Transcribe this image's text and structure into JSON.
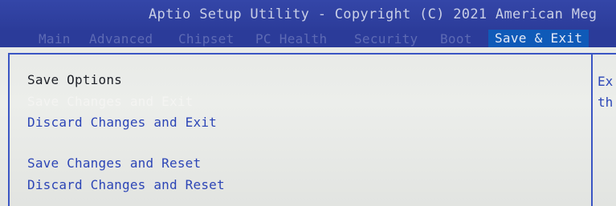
{
  "header": {
    "title": "Aptio Setup Utility - Copyright (C) 2021 American Meg"
  },
  "tabs": [
    {
      "label": "Main",
      "active": false
    },
    {
      "label": "Advanced",
      "active": false
    },
    {
      "label": "Chipset",
      "active": false
    },
    {
      "label": "PC Health",
      "active": false
    },
    {
      "label": "Security",
      "active": false
    },
    {
      "label": "Boot",
      "active": false
    },
    {
      "label": "Save & Exit",
      "active": true
    }
  ],
  "main": {
    "section_title": "Save Options",
    "items": [
      {
        "label": "Save Changes and Exit",
        "selected": true
      },
      {
        "label": "Discard Changes and Exit",
        "selected": false
      },
      {
        "label": "Save Changes and Reset",
        "selected": false
      },
      {
        "label": "Discard Changes and Reset",
        "selected": false
      }
    ]
  },
  "help": {
    "lines": [
      "Ex",
      "th"
    ]
  },
  "colors": {
    "title_bar": "#2c3c9a",
    "active_tab": "#0f5ab8",
    "item_text": "#2c45b6",
    "selected_text": "#f4f4f2",
    "border": "#3a55c4"
  }
}
